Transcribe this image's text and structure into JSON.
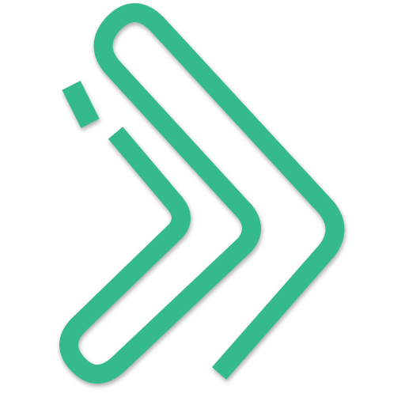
{
  "logo": {
    "icon": "double-chevron-right-logo",
    "colors": {
      "primary": "#36BA8C",
      "shadow": "#1F6F53",
      "background": "#FFFFFF"
    }
  }
}
